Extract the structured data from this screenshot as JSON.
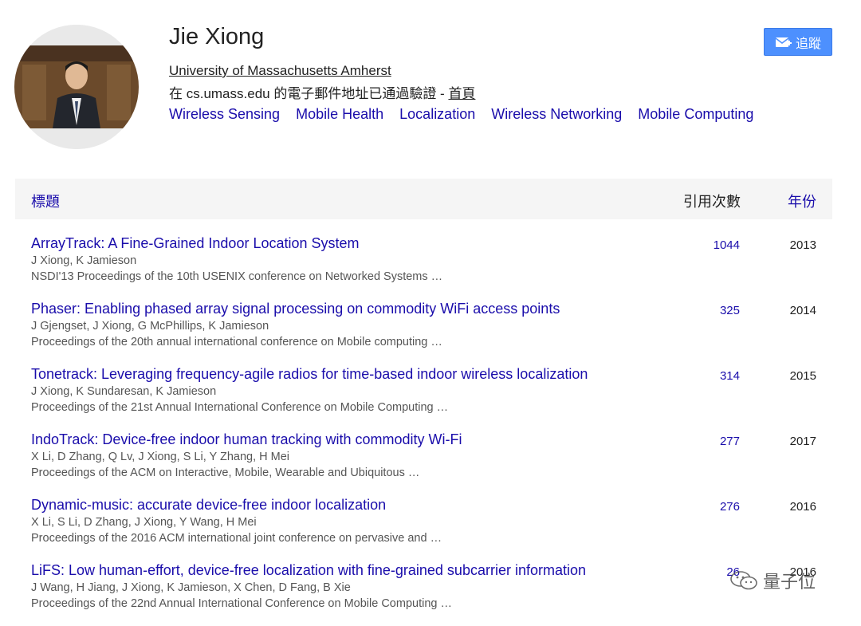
{
  "profile": {
    "name": "Jie Xiong",
    "affiliation": "University of Massachusetts Amherst",
    "verified_text": "在 cs.umass.edu 的電子郵件地址已通過驗證 - ",
    "homepage_label": "首頁",
    "interests": [
      "Wireless Sensing",
      "Mobile Health",
      "Localization",
      "Wireless Networking",
      "Mobile Computing"
    ],
    "follow_label": "追蹤"
  },
  "table": {
    "header_title": "標題",
    "header_cites": "引用次數",
    "header_year": "年份",
    "rows": [
      {
        "title": "ArrayTrack: A Fine-Grained Indoor Location System",
        "authors": "J Xiong, K Jamieson",
        "venue": "NSDI'13 Proceedings of the 10th USENIX conference on Networked Systems …",
        "cites": "1044",
        "year": "2013"
      },
      {
        "title": "Phaser: Enabling phased array signal processing on commodity WiFi access points",
        "authors": "J Gjengset, J Xiong, G McPhillips, K Jamieson",
        "venue": "Proceedings of the 20th annual international conference on Mobile computing …",
        "cites": "325",
        "year": "2014"
      },
      {
        "title": "Tonetrack: Leveraging frequency-agile radios for time-based indoor wireless localization",
        "authors": "J Xiong, K Sundaresan, K Jamieson",
        "venue": "Proceedings of the 21st Annual International Conference on Mobile Computing …",
        "cites": "314",
        "year": "2015"
      },
      {
        "title": "IndoTrack: Device-free indoor human tracking with commodity Wi-Fi",
        "authors": "X Li, D Zhang, Q Lv, J Xiong, S Li, Y Zhang, H Mei",
        "venue": "Proceedings of the ACM on Interactive, Mobile, Wearable and Ubiquitous …",
        "cites": "277",
        "year": "2017"
      },
      {
        "title": "Dynamic-music: accurate device-free indoor localization",
        "authors": "X Li, S Li, D Zhang, J Xiong, Y Wang, H Mei",
        "venue": "Proceedings of the 2016 ACM international joint conference on pervasive and …",
        "cites": "276",
        "year": "2016"
      },
      {
        "title": "LiFS: Low human-effort, device-free localization with fine-grained subcarrier information",
        "authors": "J Wang, H Jiang, J Xiong, K Jamieson, X Chen, D Fang, B Xie",
        "venue": "Proceedings of the 22nd Annual International Conference on Mobile Computing …",
        "cites": "26",
        "year": "2016"
      }
    ]
  },
  "watermark": {
    "text": "量子位"
  }
}
